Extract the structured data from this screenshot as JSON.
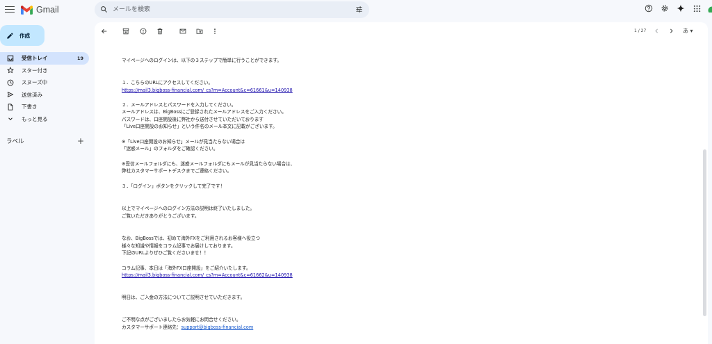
{
  "app": {
    "name": "Gmail",
    "brand_colors": {
      "red": "#ea4335",
      "blue": "#4285f4",
      "green": "#34a853",
      "yellow": "#fbbc04"
    }
  },
  "search": {
    "placeholder": "メールを検索",
    "value": ""
  },
  "compose": {
    "label": "作成"
  },
  "nav": [
    {
      "label": "受信トレイ",
      "count": "19",
      "icon": "inbox-icon",
      "active": true
    },
    {
      "label": "スター付き",
      "count": "",
      "icon": "star-icon",
      "active": false
    },
    {
      "label": "スヌーズ中",
      "count": "",
      "icon": "clock-icon",
      "active": false
    },
    {
      "label": "送信済み",
      "count": "",
      "icon": "send-icon",
      "active": false
    },
    {
      "label": "下書き",
      "count": "",
      "icon": "draft-icon",
      "active": false
    },
    {
      "label": "もっと見る",
      "count": "",
      "icon": "chevron-down-icon",
      "active": false
    }
  ],
  "labels": {
    "title": "ラベル",
    "add": "+"
  },
  "toolbar": {
    "pager": "1 / 27",
    "language": "あ ▾"
  },
  "email": {
    "lines": [
      {
        "text": "マイページへのログインは、以下の３ステップで簡単に行うことができます。",
        "type": "text"
      },
      {
        "text": "１．こちらのURLにアクセスしてください。",
        "type": "text"
      },
      {
        "text": "https://mail3.bigboss-financial.com/_cs?m=Account&c=61661&u=140938",
        "type": "link"
      },
      {
        "text": "２．メールアドレスとパスワードを入力してください。",
        "type": "text"
      },
      {
        "text": "メールアドレスは、BigBossにご登録されたメールアドレスをご入力ください。",
        "type": "text"
      },
      {
        "text": "パスワードは、口座開設後に弊社から送付させていただいております",
        "type": "text"
      },
      {
        "text": "「Live口座開設のお知らせ」という件名のメール本文に記載がございます。",
        "type": "text"
      },
      {
        "text": "※「Live口座開設のお知らせ」メールが見当たらない場合は",
        "type": "text"
      },
      {
        "text": "「迷惑メール」のフォルダをご確認ください。",
        "type": "text"
      },
      {
        "text": "※受信メールフォルダにも、迷惑メールフォルダにもメールが見当たらない場合は、",
        "type": "text"
      },
      {
        "text": "弊社カスタマーサポートデスクまでご連絡ください。",
        "type": "text"
      },
      {
        "text": "３．「ログイン」ボタンをクリックして完了です！",
        "type": "text"
      },
      {
        "text": "以上でマイページへのログイン方法の説明は終了いたしました。",
        "type": "text"
      },
      {
        "text": "ご覧いただきありがとうございます。",
        "type": "text"
      },
      {
        "text": "なお、BigBossでは、初めて海外FXをご利用されるお客様へ役立つ",
        "type": "text"
      },
      {
        "text": "様々な知識や情報をコラム記事でお届けしております。",
        "type": "text"
      },
      {
        "text": "下記のURLよりぜひご覧くださいませ！！",
        "type": "text"
      },
      {
        "text": "コラム記事、本日は「海外FX口座開設」をご紹介いたします。",
        "type": "text"
      },
      {
        "text": "https://mail3.bigboss-financial.com/_cs?m=Account&c=61662&u=140938",
        "type": "link"
      },
      {
        "text": "明日は、ご入金の方法についてご説明させていただきます。",
        "type": "text"
      },
      {
        "text": "ご不明な点がございましたらお気軽にお問合せください。",
        "type": "text"
      },
      {
        "text": "カスタマーサポート連絡先：",
        "type": "text"
      },
      {
        "text": "support@bigboss-financial.com",
        "type": "link"
      }
    ]
  }
}
